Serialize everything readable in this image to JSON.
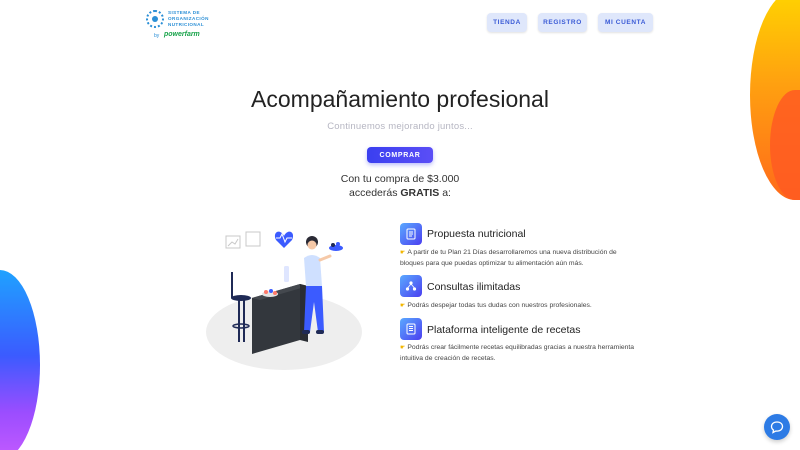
{
  "header": {
    "logo_lines": [
      "Sistema de",
      "Organización",
      "Nutricional"
    ],
    "logo_by": "by",
    "logo_brand": "powerfarm",
    "nav": [
      "TIENDA",
      "REGISTRO",
      "MI CUENTA"
    ]
  },
  "hero": {
    "title": "Acompañamiento profesional",
    "subtitle": "Continuemos mejorando juntos...",
    "cta": "COMPRAR",
    "offer_line1": "Con tu compra de $3.000",
    "offer_line2_pre": "accederás",
    "offer_line2_bold": "GRATIS",
    "offer_line2_post": "a:"
  },
  "features": [
    {
      "icon": "document-list-icon",
      "title": "Propuesta nutricional",
      "desc": "A partir de tu Plan 21 Días desarrollaremos una nueva distribución de bloques para que puedas optimizar tu alimentación aún más."
    },
    {
      "icon": "network-icon",
      "title": "Consultas ilimitadas",
      "desc": "Podrás despejar todas tus dudas con nuestros profesionales."
    },
    {
      "icon": "recipe-list-icon",
      "title": "Plataforma inteligente de recetas",
      "desc": "Podrás crear fácilmente recetas equilibradas gracias a nuestra herramienta intuitiva de creación de recetas."
    }
  ],
  "colors": {
    "accent": "#3a3ff0",
    "nav_bg": "#dfe7fb",
    "nav_text": "#3b5bd6",
    "chat": "#2d7be5"
  }
}
